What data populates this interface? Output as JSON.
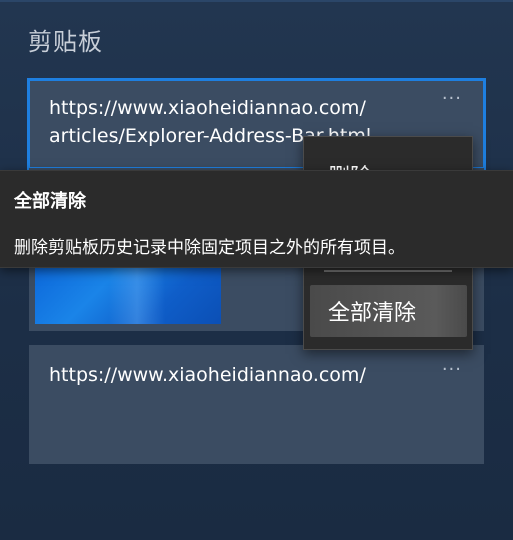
{
  "panel": {
    "title": "剪贴板"
  },
  "items": [
    {
      "text": "https://www.xiaoheidiannao.com/\narticles/Explorer-Address-Bar.html",
      "more": "···"
    },
    {
      "more": "···"
    },
    {
      "text": "https://www.xiaoheidiannao.com/",
      "more": "···"
    }
  ],
  "context_menu": {
    "items": [
      {
        "label": "删除"
      },
      {
        "label": "全部清除"
      }
    ]
  },
  "tooltip": {
    "title": "全部清除",
    "description": "删除剪贴板历史记录中除固定项目之外的所有项目。"
  },
  "colors": {
    "accent": "#1e7fe0",
    "card": "#3b4c62",
    "menu_bg": "#2b2b2b",
    "background": "#1d2f48"
  }
}
